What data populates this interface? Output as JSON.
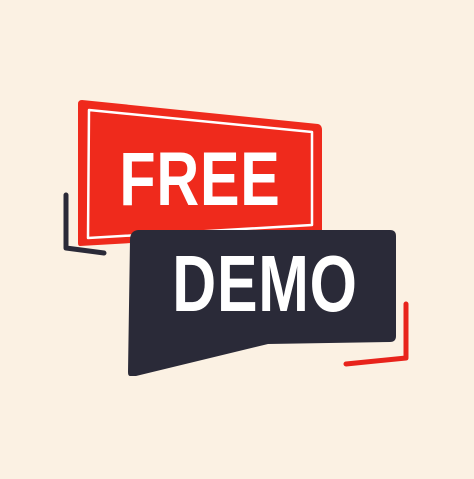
{
  "badge": {
    "top_label": "FREE",
    "bottom_label": "DEMO"
  },
  "colors": {
    "background": "#fbf1e3",
    "red": "#ef2a1c",
    "dark": "#2a2a38",
    "text": "#ffffff",
    "accent_line_red": "#e8231b",
    "accent_line_dark": "#2a2a38"
  }
}
